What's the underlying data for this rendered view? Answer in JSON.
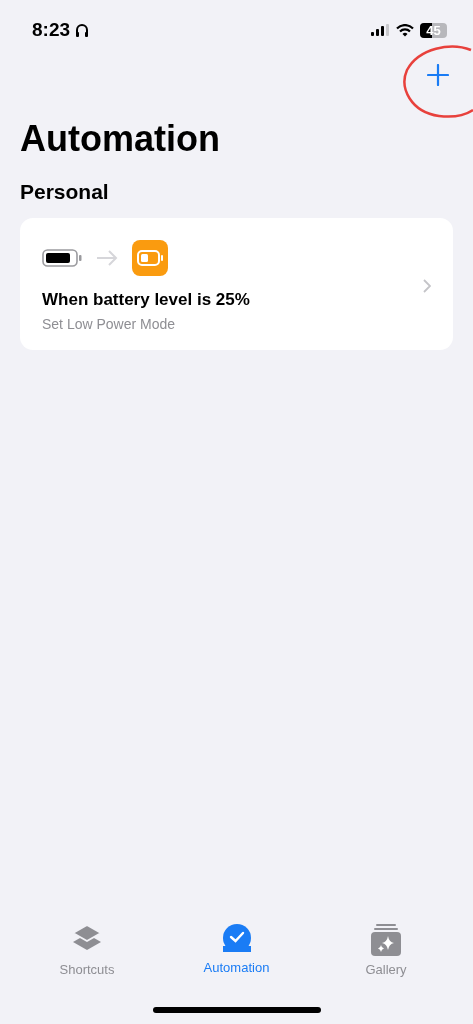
{
  "status_bar": {
    "time": "8:23",
    "battery": "45"
  },
  "title": "Automation",
  "section": "Personal",
  "automations": [
    {
      "title": "When battery level is 25%",
      "subtitle": "Set Low Power Mode"
    }
  ],
  "tabs": [
    {
      "label": "Shortcuts",
      "kind": "layers",
      "selected": false
    },
    {
      "label": "Automation",
      "kind": "check",
      "selected": true
    },
    {
      "label": "Gallery",
      "kind": "gallery",
      "selected": false
    }
  ]
}
